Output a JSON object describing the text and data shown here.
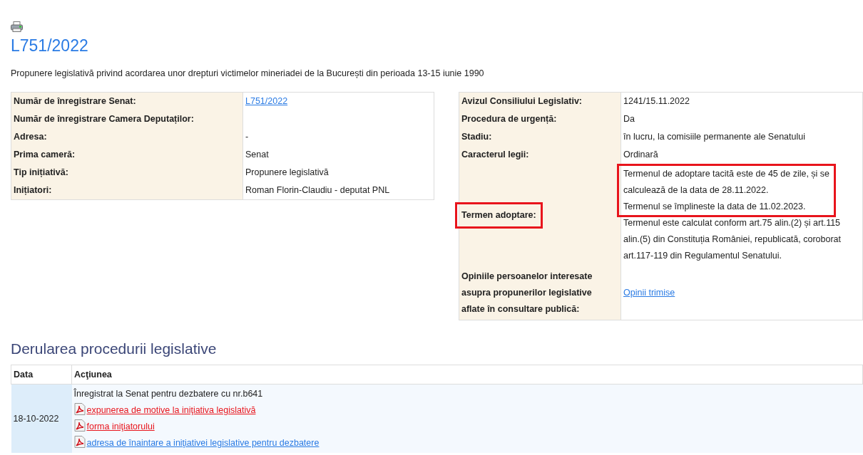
{
  "title": "L751/2022",
  "description": "Propunere legislativă privind acordarea unor drepturi victimelor mineriadei de la București din perioada 13-15 iunie 1990",
  "info_left": [
    {
      "label": "Număr de înregistrare Senat:",
      "value": "L751/2022",
      "kind": "link"
    },
    {
      "label": "Număr de înregistrare Camera Deputaților:",
      "kind": "text"
    },
    {
      "label": "Adresa:",
      "value": "-",
      "kind": "text"
    },
    {
      "label": "Prima cameră:",
      "value": "Senat",
      "kind": "text"
    },
    {
      "label": "Tip inițiativă:",
      "value": "Propunere legislativă",
      "kind": "text"
    },
    {
      "label": "Inițiatori:",
      "value": "Roman Florin-Claudiu - deputat PNL",
      "kind": "text"
    }
  ],
  "info_right": [
    {
      "label": "Avizul Consiliului Legislativ:",
      "value": "1241/15.11.2022",
      "kind": "text",
      "highlighted": false
    },
    {
      "label": "Procedura de urgență:",
      "value": "Da",
      "kind": "text",
      "highlighted": false
    },
    {
      "label": "Stadiu:",
      "value": "în lucru, la comisiile permanente ale Senatului",
      "kind": "text",
      "highlighted": false
    },
    {
      "label": "Caracterul legii:",
      "value": "Ordinară",
      "kind": "text",
      "highlighted": false
    },
    {
      "label": "Termen adoptare:",
      "kind": "notes",
      "highlighted": true,
      "notes": [
        {
          "lines": [
            "Termenul de adoptare tacită este de 45 de zile, și se",
            "calculează de la data de 28.11.2022."
          ],
          "highlighted": true
        },
        {
          "lines": [
            "Termenul se împlineste la data de 11.02.2023."
          ],
          "highlighted": true
        },
        {
          "lines": [
            "Termenul este calculat conform art.75 alin.(2) și art.115",
            "alin.(5) din Constituția României, republicată, coroborat",
            "art.117-119 din Regulamentul Senatului."
          ],
          "highlighted": false
        }
      ]
    },
    {
      "label_lines": [
        "Opiniile persoanelor interesate",
        "asupra propunerilor legislative",
        "aflate în consultare publică:"
      ],
      "value": "Opinii trimise",
      "kind": "link",
      "highlighted": false
    }
  ],
  "procedure": {
    "heading": "Derularea procedurii legislative",
    "columns": [
      "Data",
      "Acţiunea"
    ],
    "rows": [
      {
        "date": "18-10-2022",
        "actions": [
          {
            "kind": "text",
            "text": "Înregistrat la Senat pentru dezbatere cu nr.b641"
          },
          {
            "kind": "pdf",
            "text": "expunerea de motive la iniţiativa legislativă",
            "color": "#e8141c"
          },
          {
            "kind": "pdf",
            "text": "forma iniţiatorului",
            "color": "#e8141c"
          },
          {
            "kind": "pdf",
            "text": "adresa de înaintare a iniţiativei legislative pentru dezbatere",
            "color": "#2a7be4"
          }
        ]
      }
    ]
  }
}
